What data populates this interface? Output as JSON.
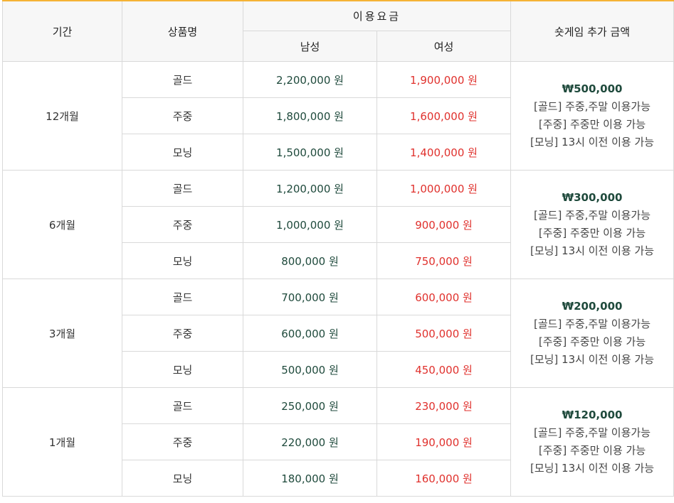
{
  "headers": {
    "period": "기간",
    "product": "상품명",
    "fee": "이용요금",
    "male": "남성",
    "female": "여성",
    "extra": "숏게임 추가 금액"
  },
  "groups": [
    {
      "period": "12개월",
      "rows": [
        {
          "product": "골드",
          "male": "2,200,000 원",
          "female": "1,900,000 원"
        },
        {
          "product": "주중",
          "male": "1,800,000 원",
          "female": "1,600,000 원"
        },
        {
          "product": "모닝",
          "male": "1,500,000 원",
          "female": "1,400,000 원"
        }
      ],
      "extra": {
        "amount": "₩500,000",
        "lines": [
          "[골드] 주중,주말 이용가능",
          "[주중] 주중만 이용 가능",
          "[모닝] 13시 이전 이용 가능"
        ]
      }
    },
    {
      "period": "6개월",
      "rows": [
        {
          "product": "골드",
          "male": "1,200,000 원",
          "female": "1,000,000 원"
        },
        {
          "product": "주중",
          "male": "1,000,000 원",
          "female": "900,000 원"
        },
        {
          "product": "모닝",
          "male": "800,000 원",
          "female": "750,000 원"
        }
      ],
      "extra": {
        "amount": "₩300,000",
        "lines": [
          "[골드] 주중,주말 이용가능",
          "[주중] 주중만 이용 가능",
          "[모닝] 13시 이전 이용 가능"
        ]
      }
    },
    {
      "period": "3개월",
      "rows": [
        {
          "product": "골드",
          "male": "700,000 원",
          "female": "600,000 원"
        },
        {
          "product": "주중",
          "male": "600,000 원",
          "female": "500,000 원"
        },
        {
          "product": "모닝",
          "male": "500,000 원",
          "female": "450,000 원"
        }
      ],
      "extra": {
        "amount": "₩200,000",
        "lines": [
          "[골드] 주중,주말 이용가능",
          "[주중] 주중만 이용 가능",
          "[모닝] 13시 이전 이용 가능"
        ]
      }
    },
    {
      "period": "1개월",
      "rows": [
        {
          "product": "골드",
          "male": "250,000 원",
          "female": "230,000 원"
        },
        {
          "product": "주중",
          "male": "220,000 원",
          "female": "190,000 원"
        },
        {
          "product": "모닝",
          "male": "180,000 원",
          "female": "160,000 원"
        }
      ],
      "extra": {
        "amount": "₩120,000",
        "lines": [
          "[골드] 주중,주말 이용가능",
          "[주중] 주중만 이용 가능",
          "[모닝] 13시 이전 이용 가능"
        ]
      }
    }
  ],
  "colors": {
    "accent": "#f5b335",
    "male": "#1f4a3c",
    "female": "#e0312d"
  }
}
